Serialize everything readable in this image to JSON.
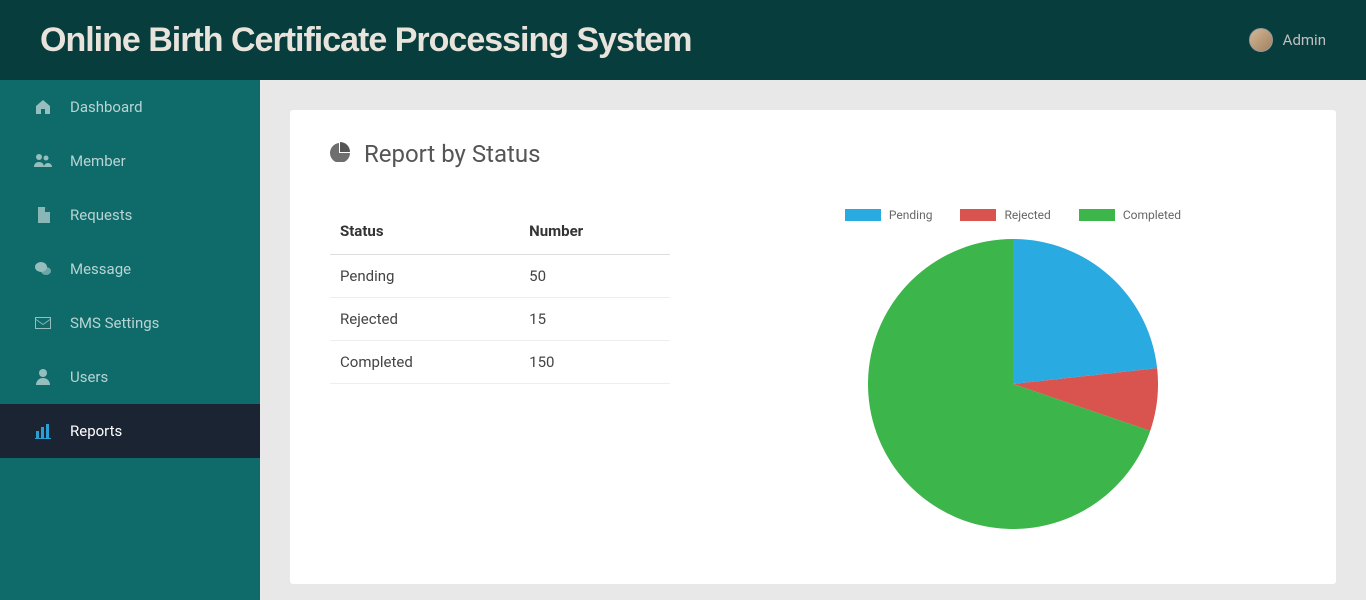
{
  "header": {
    "title": "Online Birth Certificate Processing System",
    "user_label": "Admin"
  },
  "sidebar": {
    "items": [
      {
        "label": "Dashboard",
        "icon": "home-icon",
        "active": false
      },
      {
        "label": "Member",
        "icon": "users-icon",
        "active": false
      },
      {
        "label": "Requests",
        "icon": "file-icon",
        "active": false
      },
      {
        "label": "Message",
        "icon": "chat-icon",
        "active": false
      },
      {
        "label": "SMS Settings",
        "icon": "envelope-icon",
        "active": false
      },
      {
        "label": "Users",
        "icon": "user-icon",
        "active": false
      },
      {
        "label": "Reports",
        "icon": "bar-chart-icon",
        "active": true
      }
    ]
  },
  "report": {
    "title": "Report by Status",
    "columns": {
      "status": "Status",
      "number": "Number"
    },
    "rows": [
      {
        "status": "Pending",
        "number": "50"
      },
      {
        "status": "Rejected",
        "number": "15"
      },
      {
        "status": "Completed",
        "number": "150"
      }
    ]
  },
  "colors": {
    "pending": "#29abe2",
    "rejected": "#d9534f",
    "completed": "#3cb54a"
  },
  "chart_data": {
    "type": "pie",
    "title": "Report by Status",
    "series": [
      {
        "name": "Pending",
        "value": 50,
        "color": "#29abe2"
      },
      {
        "name": "Rejected",
        "value": 15,
        "color": "#d9534f"
      },
      {
        "name": "Completed",
        "value": 150,
        "color": "#3cb54a"
      }
    ]
  }
}
